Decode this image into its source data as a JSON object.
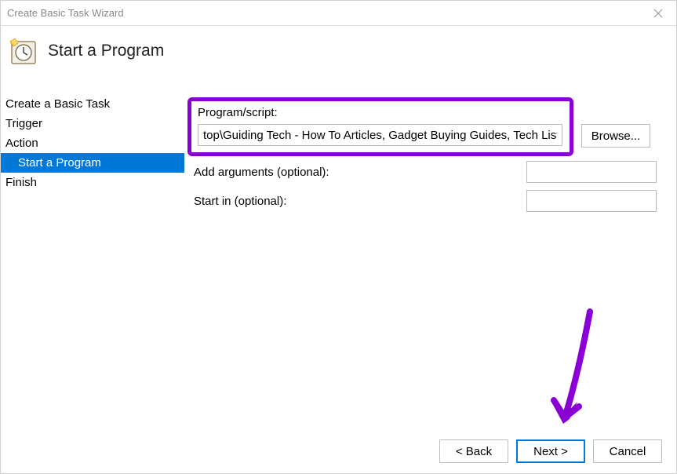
{
  "window": {
    "title": "Create Basic Task Wizard"
  },
  "header": {
    "title": "Start a Program"
  },
  "sidebar": {
    "items": [
      {
        "label": "Create a Basic Task",
        "selected": false,
        "indent": false
      },
      {
        "label": "Trigger",
        "selected": false,
        "indent": false
      },
      {
        "label": "Action",
        "selected": false,
        "indent": false
      },
      {
        "label": "Start a Program",
        "selected": true,
        "indent": true
      },
      {
        "label": "Finish",
        "selected": false,
        "indent": false
      }
    ]
  },
  "form": {
    "program_label": "Program/script:",
    "program_value": "top\\Guiding Tech - How To Articles, Gadget Buying Guides, Tech Lists.url\"",
    "browse_label": "Browse...",
    "arguments_label": "Add arguments (optional):",
    "arguments_value": "",
    "startin_label": "Start in (optional):",
    "startin_value": ""
  },
  "footer": {
    "back_label": "< Back",
    "next_label": "Next >",
    "cancel_label": "Cancel"
  },
  "annotation": {
    "highlight_color": "#8a00d4",
    "arrow_color": "#8a00d4"
  }
}
